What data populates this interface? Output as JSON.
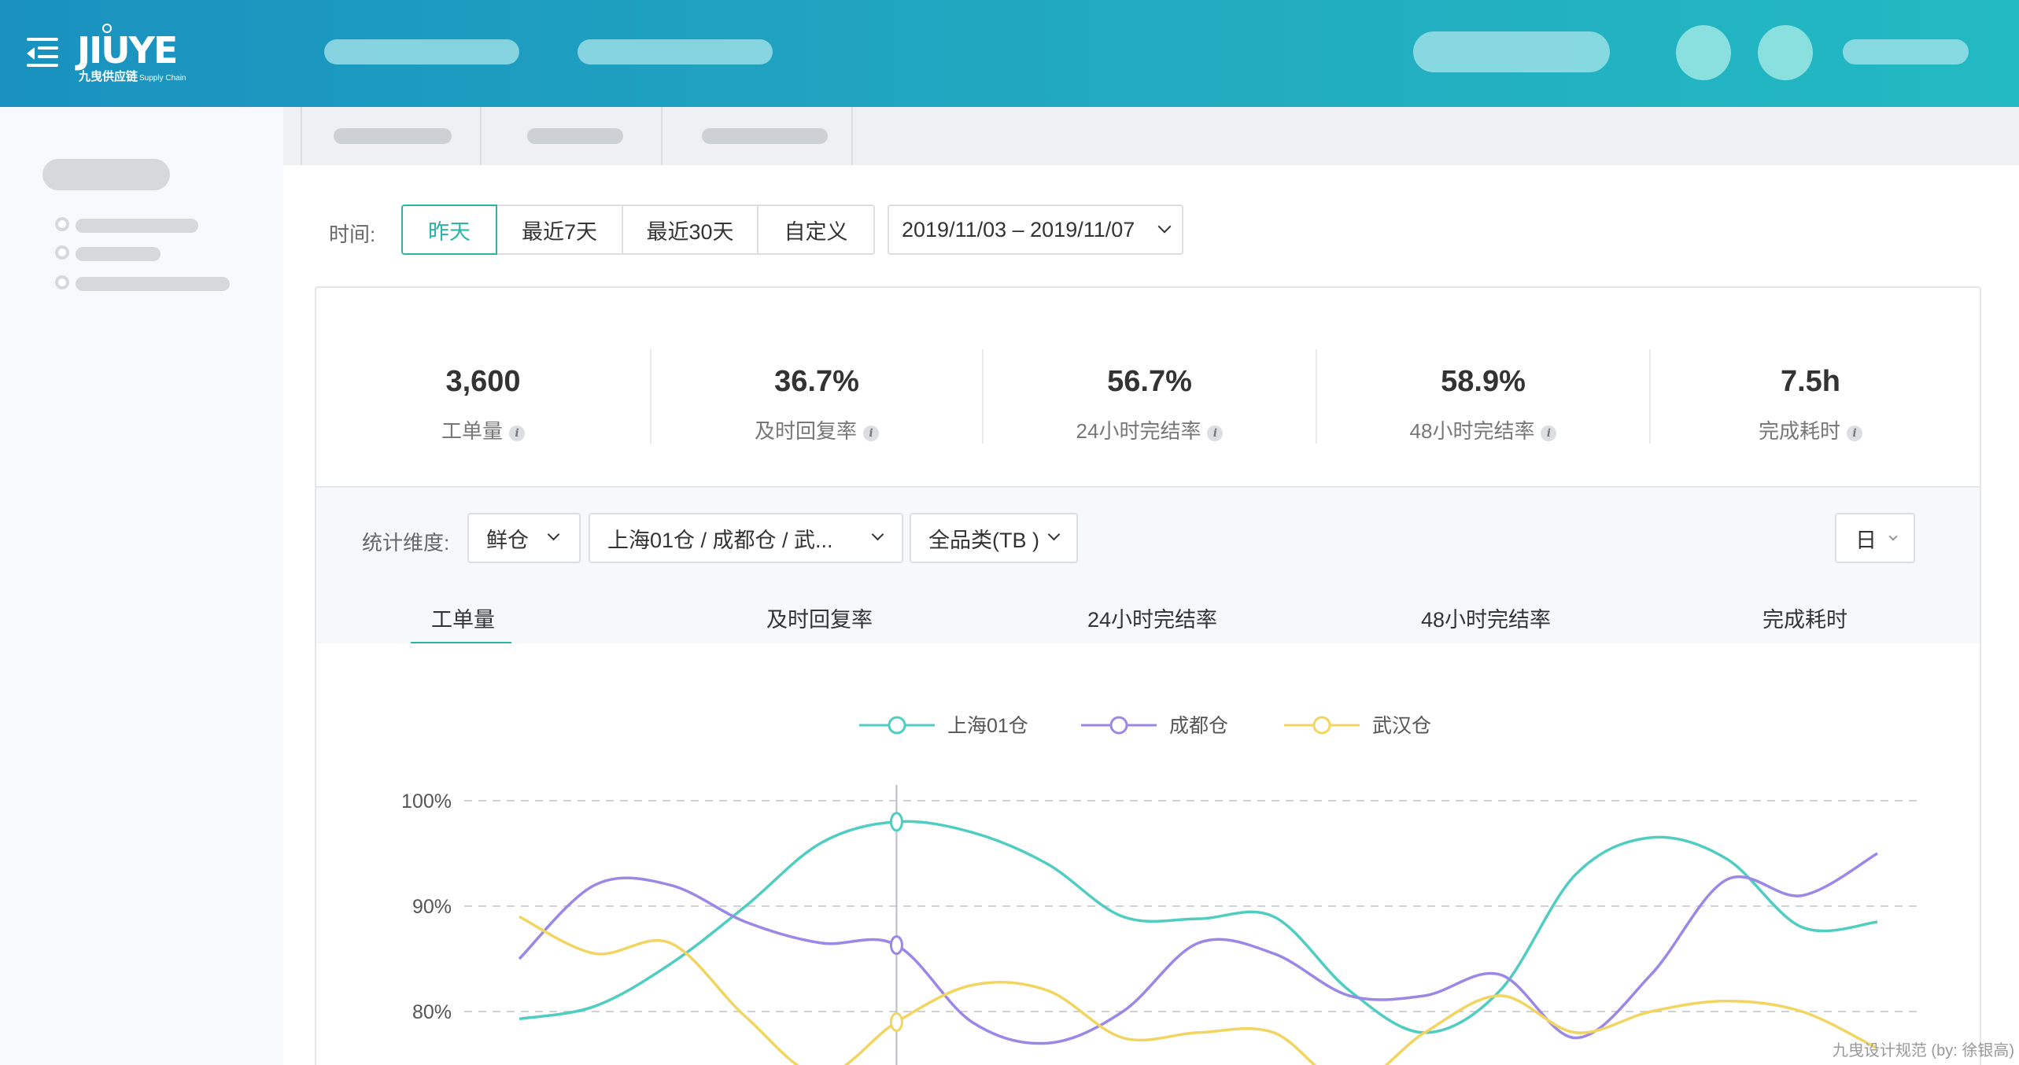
{
  "header": {
    "logo_main": "JIUYE",
    "logo_sub": "九曳供应链",
    "logo_tag": "Supply Chain"
  },
  "filter": {
    "time_label": "时间:",
    "segments": [
      "昨天",
      "最近7天",
      "最近30天",
      "自定义"
    ],
    "date_range": "2019/11/03 – 2019/11/07"
  },
  "kpis": [
    {
      "value": "3,600",
      "label": "工单量"
    },
    {
      "value": "36.7%",
      "label": "及时回复率"
    },
    {
      "value": "56.7%",
      "label": "24小时完结率"
    },
    {
      "value": "58.9%",
      "label": "48小时完结率"
    },
    {
      "value": "7.5h",
      "label": "完成耗时"
    }
  ],
  "dimension": {
    "label": "统计维度:",
    "warehouse_type": "鲜仓",
    "warehouses": "上海01仓 / 成都仓 / 武...",
    "category": "全品类(TB )",
    "granularity": "日"
  },
  "metric_tabs": [
    "工单量",
    "及时回复率",
    "24小时完结率",
    "48小时完结率",
    "完成耗时"
  ],
  "colors": {
    "accent": "#2bb5a3",
    "series_teal": "#4ecdc0",
    "series_purple": "#9b87e6",
    "series_yellow": "#f2d560"
  },
  "chart_data": {
    "type": "line",
    "legend_position": "top-center",
    "y_ticks": [
      "100%",
      "90%",
      "80%"
    ],
    "ylim": [
      70,
      100
    ],
    "x": [
      0,
      1,
      2,
      3,
      4,
      5,
      6,
      7,
      8,
      9,
      10,
      11,
      12,
      13,
      14,
      15,
      16,
      17,
      18
    ],
    "highlight_index": 5,
    "series": [
      {
        "name": "上海01仓",
        "color": "#4ecdc0",
        "values": [
          79.3,
          80.5,
          84.5,
          90,
          96,
          98,
          97,
          94,
          89,
          88.8,
          89,
          82,
          78,
          82,
          93,
          96.5,
          94.5,
          88,
          88.5
        ]
      },
      {
        "name": "成都仓",
        "color": "#9b87e6",
        "values": [
          85,
          92,
          92,
          88.5,
          86.5,
          86.3,
          79,
          77,
          80,
          86.5,
          85.5,
          81.5,
          81.5,
          83.5,
          77.5,
          83.5,
          92.5,
          91,
          95
        ]
      },
      {
        "name": "武汉仓",
        "color": "#f2d560",
        "values": [
          89,
          85.5,
          86.5,
          79.5,
          74,
          79,
          82.5,
          82,
          77.5,
          78,
          78,
          73,
          78,
          81.5,
          78,
          80,
          81,
          80,
          76.5
        ]
      }
    ]
  },
  "watermark": "九曳设计规范 (by: 徐银高)"
}
